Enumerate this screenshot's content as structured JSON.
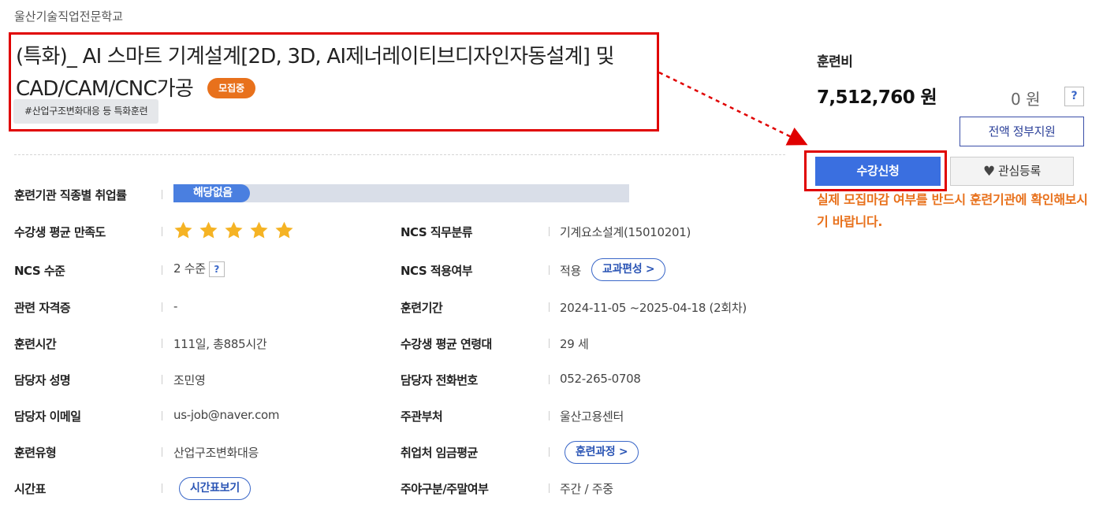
{
  "institution": "울산기술직업전문학교",
  "course": {
    "title": "(특화)_ AI 스마트 기계설계[2D, 3D, AI제너레이티브디자인자동설계] 및 CAD/CAM/CNC가공",
    "status_badge": "모집중",
    "tag": "#산업구조변화대응 등 특화훈련"
  },
  "details": {
    "employment_rate": {
      "label": "훈련기관 직종별 취업률",
      "value": "해당없음"
    },
    "satisfaction": {
      "label": "수강생 평균 만족도",
      "stars": 5,
      "star_color": "#f5b324"
    },
    "ncs_category": {
      "label": "NCS 직무분류",
      "value": "기계요소설계(15010201)"
    },
    "ncs_level": {
      "label": "NCS 수준",
      "value": "2 수준",
      "help": "?"
    },
    "ncs_applied": {
      "label": "NCS 적용여부",
      "value": "적용",
      "button": "교과편성 >"
    },
    "certificate": {
      "label": "관련 자격증",
      "value": "-"
    },
    "period": {
      "label": "훈련기간",
      "value": "2024-11-05 ~2025-04-18 (2회차)"
    },
    "hours": {
      "label": "훈련시간",
      "value": "111일, 총885시간"
    },
    "avg_age": {
      "label": "수강생 평균 연령대",
      "value": "29 세"
    },
    "manager_name": {
      "label": "담당자 성명",
      "value": "조민영"
    },
    "manager_phone": {
      "label": "담당자 전화번호",
      "value": "052-265-0708"
    },
    "manager_email": {
      "label": "담당자 이메일",
      "value": "us-job@naver.com"
    },
    "ministry": {
      "label": "주관부처",
      "value": "울산고용센터"
    },
    "training_type": {
      "label": "훈련유형",
      "value": "산업구조변화대응"
    },
    "wage_avg": {
      "label": "취업처 임금평균",
      "button": "훈련과정 >"
    },
    "timetable": {
      "label": "시간표",
      "button": "시간표보기"
    },
    "day_night": {
      "label": "주야구분/주말여부",
      "value": "주간 / 주중"
    }
  },
  "fee": {
    "label": "훈련비",
    "amount": "7,512,760 원",
    "self_pay": "0 원",
    "help": "?",
    "gov_support_button": "전액 정부지원"
  },
  "actions": {
    "apply_button": "수강신청",
    "interest_button": "관심등록",
    "notice": "실제 모집마감 여부를 반드시 훈련기관에 확인해보시기 바랍니다."
  },
  "colors": {
    "highlight_red": "#e00000",
    "accent_blue": "#3a6fe0",
    "accent_orange": "#e8711c"
  }
}
